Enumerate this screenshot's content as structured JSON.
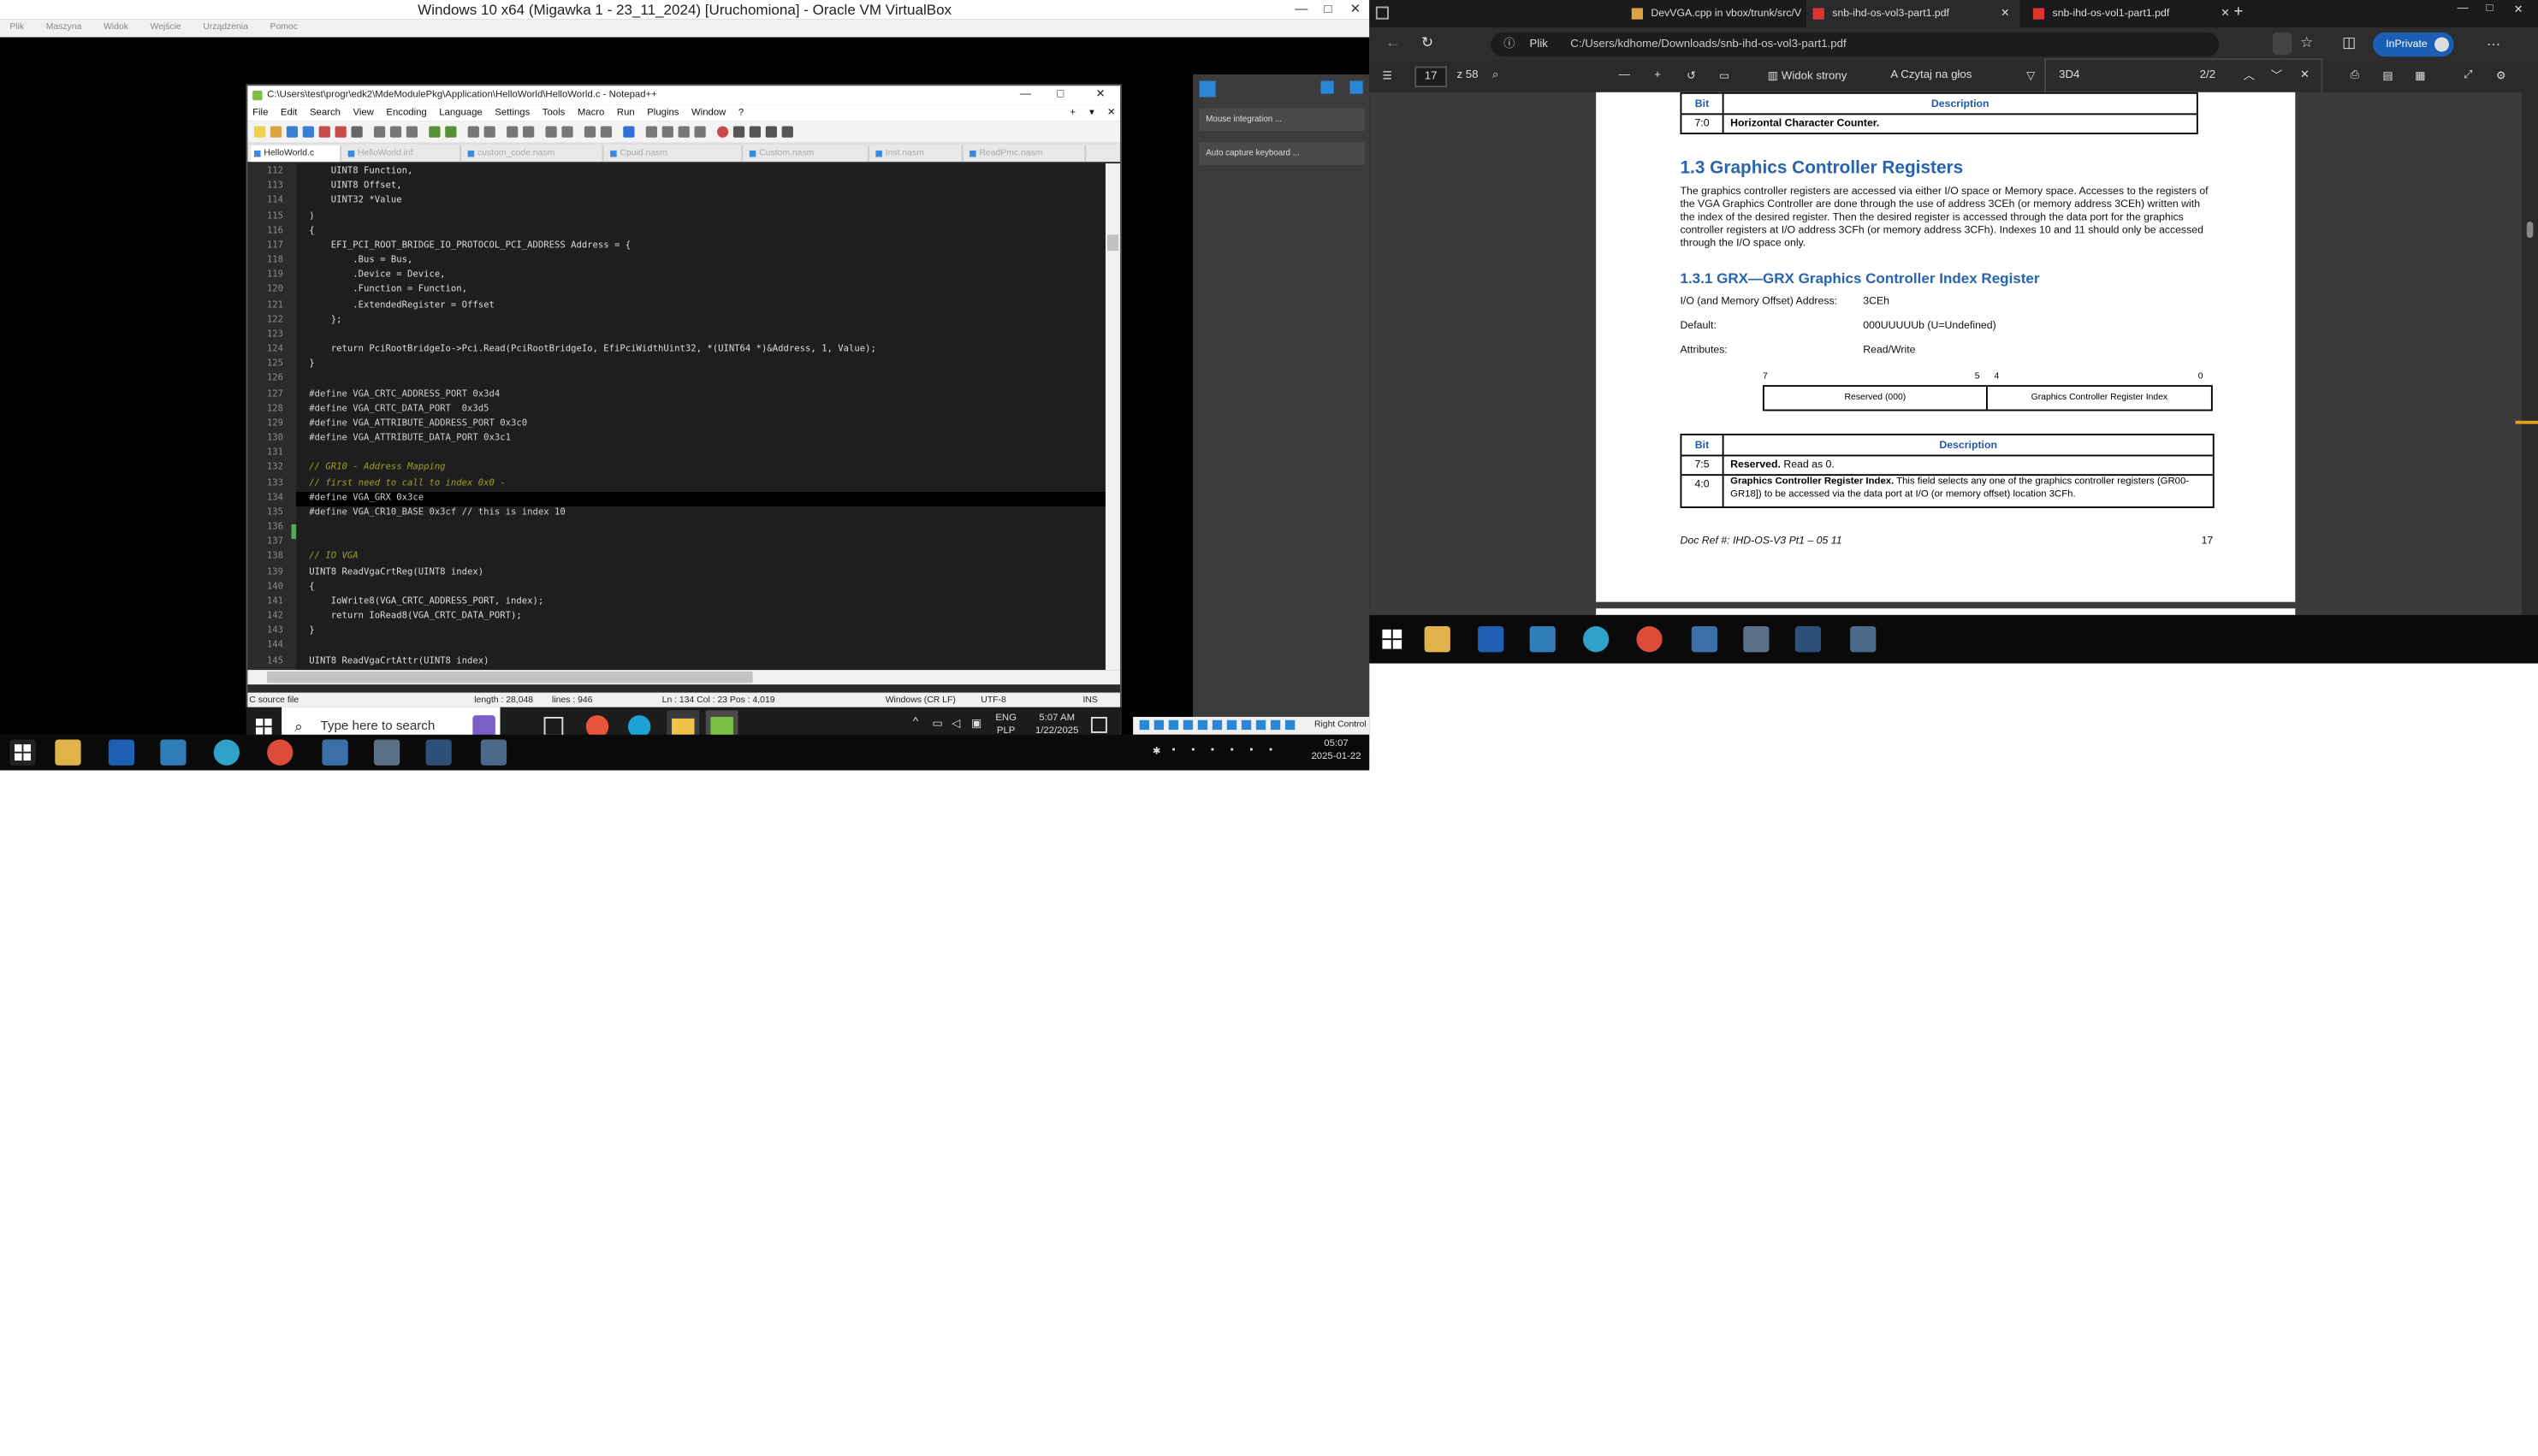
{
  "vbox": {
    "title": "Windows 10 x64 (Migawka 1 - 23_11_2024) [Uruchomiona] - Oracle VM VirtualBox",
    "menu": [
      "Plik",
      "Maszyna",
      "Widok",
      "Wejście",
      "Urządzenia",
      "Pomoc"
    ],
    "side_panel": {
      "mouse_integration": "Mouse integration ...",
      "auto_capture": "Auto capture keyboard ..."
    },
    "right_control": "Right Control"
  },
  "notepad": {
    "title": "C:\\Users\\test\\progr\\edk2\\MdeModulePkg\\Application\\HelloWorld\\HelloWorld.c - Notepad++",
    "menu": [
      "File",
      "Edit",
      "Search",
      "View",
      "Encoding",
      "Language",
      "Settings",
      "Tools",
      "Macro",
      "Run",
      "Plugins",
      "Window",
      "?"
    ],
    "tabs": [
      "HelloWorld.c",
      "HelloWorld.inf",
      "custom_code.nasm",
      "Cpuid.nasm",
      "Custom.nasm",
      "Inst.nasm",
      "ReadPmc.nasm"
    ],
    "lines": [
      {
        "n": "112",
        "t": "    UINT8 Function,",
        "k": "code"
      },
      {
        "n": "113",
        "t": "    UINT8 Offset,",
        "k": "code"
      },
      {
        "n": "114",
        "t": "    UINT32 *Value",
        "k": "code"
      },
      {
        "n": "115",
        "t": ")",
        "k": "code"
      },
      {
        "n": "116",
        "t": "{",
        "k": "code"
      },
      {
        "n": "117",
        "t": "    EFI_PCI_ROOT_BRIDGE_IO_PROTOCOL_PCI_ADDRESS Address = {",
        "k": "code"
      },
      {
        "n": "118",
        "t": "        .Bus = Bus,",
        "k": "code"
      },
      {
        "n": "119",
        "t": "        .Device = Device,",
        "k": "code"
      },
      {
        "n": "120",
        "t": "        .Function = Function,",
        "k": "code"
      },
      {
        "n": "121",
        "t": "        .ExtendedRegister = Offset",
        "k": "code"
      },
      {
        "n": "122",
        "t": "    };",
        "k": "code"
      },
      {
        "n": "123",
        "t": "",
        "k": "code"
      },
      {
        "n": "124",
        "t": "    return PciRootBridgeIo->Pci.Read(PciRootBridgeIo, EfiPciWidthUint32, *(UINT64 *)&Address, 1, Value);",
        "k": "code"
      },
      {
        "n": "125",
        "t": "}",
        "k": "code"
      },
      {
        "n": "126",
        "t": "",
        "k": "code"
      },
      {
        "n": "127",
        "t": "#define VGA_CRTC_ADDRESS_PORT 0x3d4",
        "k": "pp"
      },
      {
        "n": "128",
        "t": "#define VGA_CRTC_DATA_PORT  0x3d5",
        "k": "pp"
      },
      {
        "n": "129",
        "t": "#define VGA_ATTRIBUTE_ADDRESS_PORT 0x3c0",
        "k": "pp"
      },
      {
        "n": "130",
        "t": "#define VGA_ATTRIBUTE_DATA_PORT 0x3c1",
        "k": "pp"
      },
      {
        "n": "131",
        "t": "",
        "k": "code"
      },
      {
        "n": "132",
        "t": "// GR10 - Address Mapping",
        "k": "cmt"
      },
      {
        "n": "133",
        "t": "// first need to call to index 0x0 -",
        "k": "cmt"
      },
      {
        "n": "134",
        "t": "#define VGA_GRX 0x3ce",
        "k": "pp"
      },
      {
        "n": "135",
        "t": "#define VGA_CR10_BASE 0x3cf // this is index 10",
        "k": "pp"
      },
      {
        "n": "136",
        "t": "",
        "k": "code"
      },
      {
        "n": "137",
        "t": "",
        "k": "code"
      },
      {
        "n": "138",
        "t": "// IO VGA",
        "k": "cmt"
      },
      {
        "n": "139",
        "t": "UINT8 ReadVgaCrtReg(UINT8 index)",
        "k": "code"
      },
      {
        "n": "140",
        "t": "{",
        "k": "code"
      },
      {
        "n": "141",
        "t": "    IoWrite8(VGA_CRTC_ADDRESS_PORT, index);",
        "k": "code"
      },
      {
        "n": "142",
        "t": "    return IoRead8(VGA_CRTC_DATA_PORT);",
        "k": "code"
      },
      {
        "n": "143",
        "t": "}",
        "k": "code"
      },
      {
        "n": "144",
        "t": "",
        "k": "code"
      },
      {
        "n": "145",
        "t": "UINT8 ReadVgaCrtAttr(UINT8 index)",
        "k": "code"
      },
      {
        "n": "146",
        "t": "",
        "k": "code"
      }
    ],
    "status": {
      "type": "C source file",
      "length": "length : 28,048",
      "lines": "lines : 946",
      "pos": "Ln : 134   Col : 23   Pos : 4,019",
      "eol": "Windows (CR LF)",
      "enc": "UTF-8",
      "ins": "INS"
    }
  },
  "guest_taskbar": {
    "search": "Type here to search",
    "lang": "ENG",
    "kbd": "PLP",
    "time": "5:07 AM",
    "date": "1/22/2025"
  },
  "host_clock": {
    "time": "05:07",
    "date": "2025-01-22"
  },
  "edge": {
    "tabs": [
      "DevVGA.cpp in vbox/trunk/src/V",
      "snb-ihd-os-vol3-part1.pdf",
      "snb-ihd-os-vol1-part1.pdf"
    ],
    "file_label": "Plik",
    "url": "C:/Users/kdhome/Downloads/snb-ihd-os-vol3-part1.pdf",
    "profile": "InPrivate",
    "page_input": "17",
    "page_total": "z 58",
    "page_view": "Widok strony",
    "read_aloud": "Czytaj na głos",
    "find_query": "3D4",
    "find_count": "2/2"
  },
  "pdf": {
    "table1": {
      "bit": "Bit",
      "desc": "Description",
      "row_bit": "7:0",
      "row_desc": "Horizontal Character Counter."
    },
    "section": "1.3    Graphics Controller Registers",
    "para": "The graphics controller registers are accessed via either I/O space or Memory space. Accesses to the registers of the VGA Graphics Controller are done through the use of address 3CEh (or memory address 3CEh) written with the index of the desired register.  Then the desired register is accessed through the data port for the graphics controller registers at I/O address 3CFh (or memory address 3CFh).  Indexes 10 and 11 should only be accessed through the I/O space only.",
    "subsection": "1.3.1    GRX—GRX Graphics Controller Index Register",
    "io_label": "I/O (and Memory Offset) Address:",
    "io_value": "3CEh",
    "default_label": "Default:",
    "default_value": "000UUUUUb (U=Undefined)",
    "attr_label": "Attributes:",
    "attr_value": "Read/Write",
    "bits": [
      "7",
      "5",
      "4",
      "0"
    ],
    "field_reserved": "Reserved (000)",
    "field_index": "Graphics Controller Register Index",
    "table2": {
      "bit": "Bit",
      "desc": "Description",
      "r1_bit": "7:5",
      "r1_bold": "Reserved.",
      "r1_text": " Read as 0.",
      "r2_bit": "4:0",
      "r2_bold": "Graphics Controller Register Index.",
      "r2_text": " This field selects any one of the graphics controller registers (GR00-GR18]) to be accessed via the data port at I/O (or memory offset) location 3CFh."
    },
    "footer_ref": "Doc Ref #: IHD-OS-V3 Pt1 – 05 11",
    "footer_page": "17"
  }
}
